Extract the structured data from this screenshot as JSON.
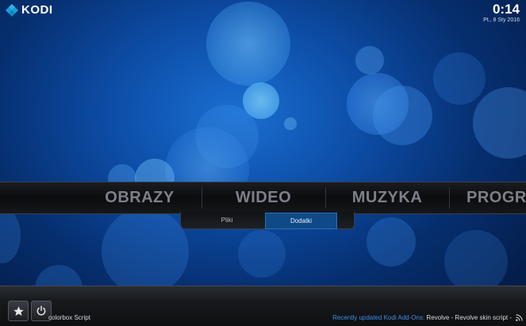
{
  "app": {
    "logo_text": "KODI"
  },
  "clock": {
    "time": "0:14",
    "date": "Pt., 8 Sty 2016"
  },
  "menu": {
    "items": [
      {
        "label": "OBRAZY"
      },
      {
        "label": "WIDEO"
      },
      {
        "label": "MUZYKA"
      },
      {
        "label": "PROGRAMY"
      }
    ]
  },
  "submenu": {
    "items": [
      {
        "label": "Pliki"
      },
      {
        "label": "Dodatki"
      }
    ],
    "selected": "Dodatki"
  },
  "footer": {
    "favourites_icon": "star-icon",
    "power_icon": "power-icon",
    "left_text": "colorbox Script",
    "ticker_label": "Recently updated Kodi Add-Ons:",
    "ticker_text": " Revolve - Revolve skin script - ",
    "rss_icon": "rss-icon"
  },
  "colors": {
    "accent": "#3f8ee6",
    "menu_text": "#7d8089",
    "submenu_active": "#0f4a86"
  }
}
